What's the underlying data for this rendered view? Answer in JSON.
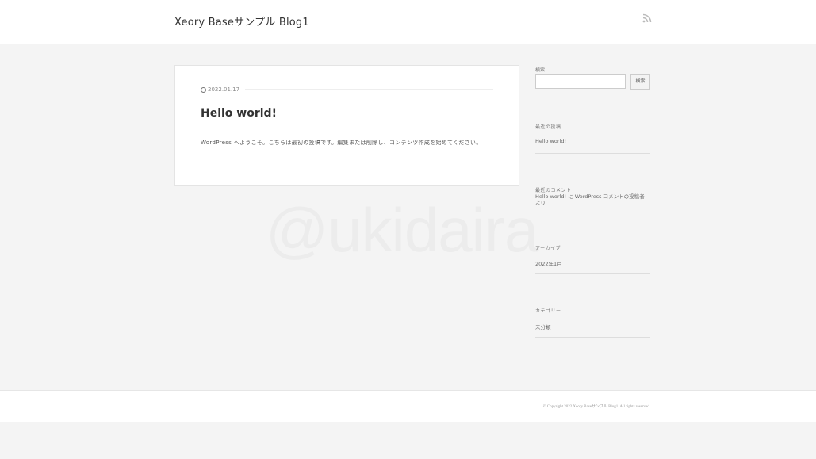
{
  "header": {
    "site_title": "Xeory Baseサンプル Blog1",
    "rss_icon": "rss-icon"
  },
  "watermark": "@ukidaira",
  "post": {
    "date": "2022.01.17",
    "title": "Hello world!",
    "excerpt": "WordPress へようこそ。こちらは最初の投稿です。編集または削除し、コンテンツ作成を始めてください。"
  },
  "sidebar": {
    "search": {
      "label": "検索",
      "button": "検索"
    },
    "recent_posts": {
      "title": "最近の投稿",
      "items": [
        "Hello world!"
      ]
    },
    "recent_comments": {
      "title": "最近のコメント",
      "author_link": "Hello world!",
      "connector": " に ",
      "post_link": "WordPress コメントの投稿者",
      "suffix": " より"
    },
    "archives": {
      "title": "アーカイブ",
      "items": [
        "2022年1月"
      ]
    },
    "categories": {
      "title": "カテゴリー",
      "items": [
        "未分類"
      ]
    }
  },
  "footer": {
    "copyright": "© Copyright 2022 Xeory Baseサンプル Blog1. All rights reserved."
  },
  "colors": {
    "background": "#f4f4f4",
    "card": "#ffffff",
    "text": "#333333"
  }
}
